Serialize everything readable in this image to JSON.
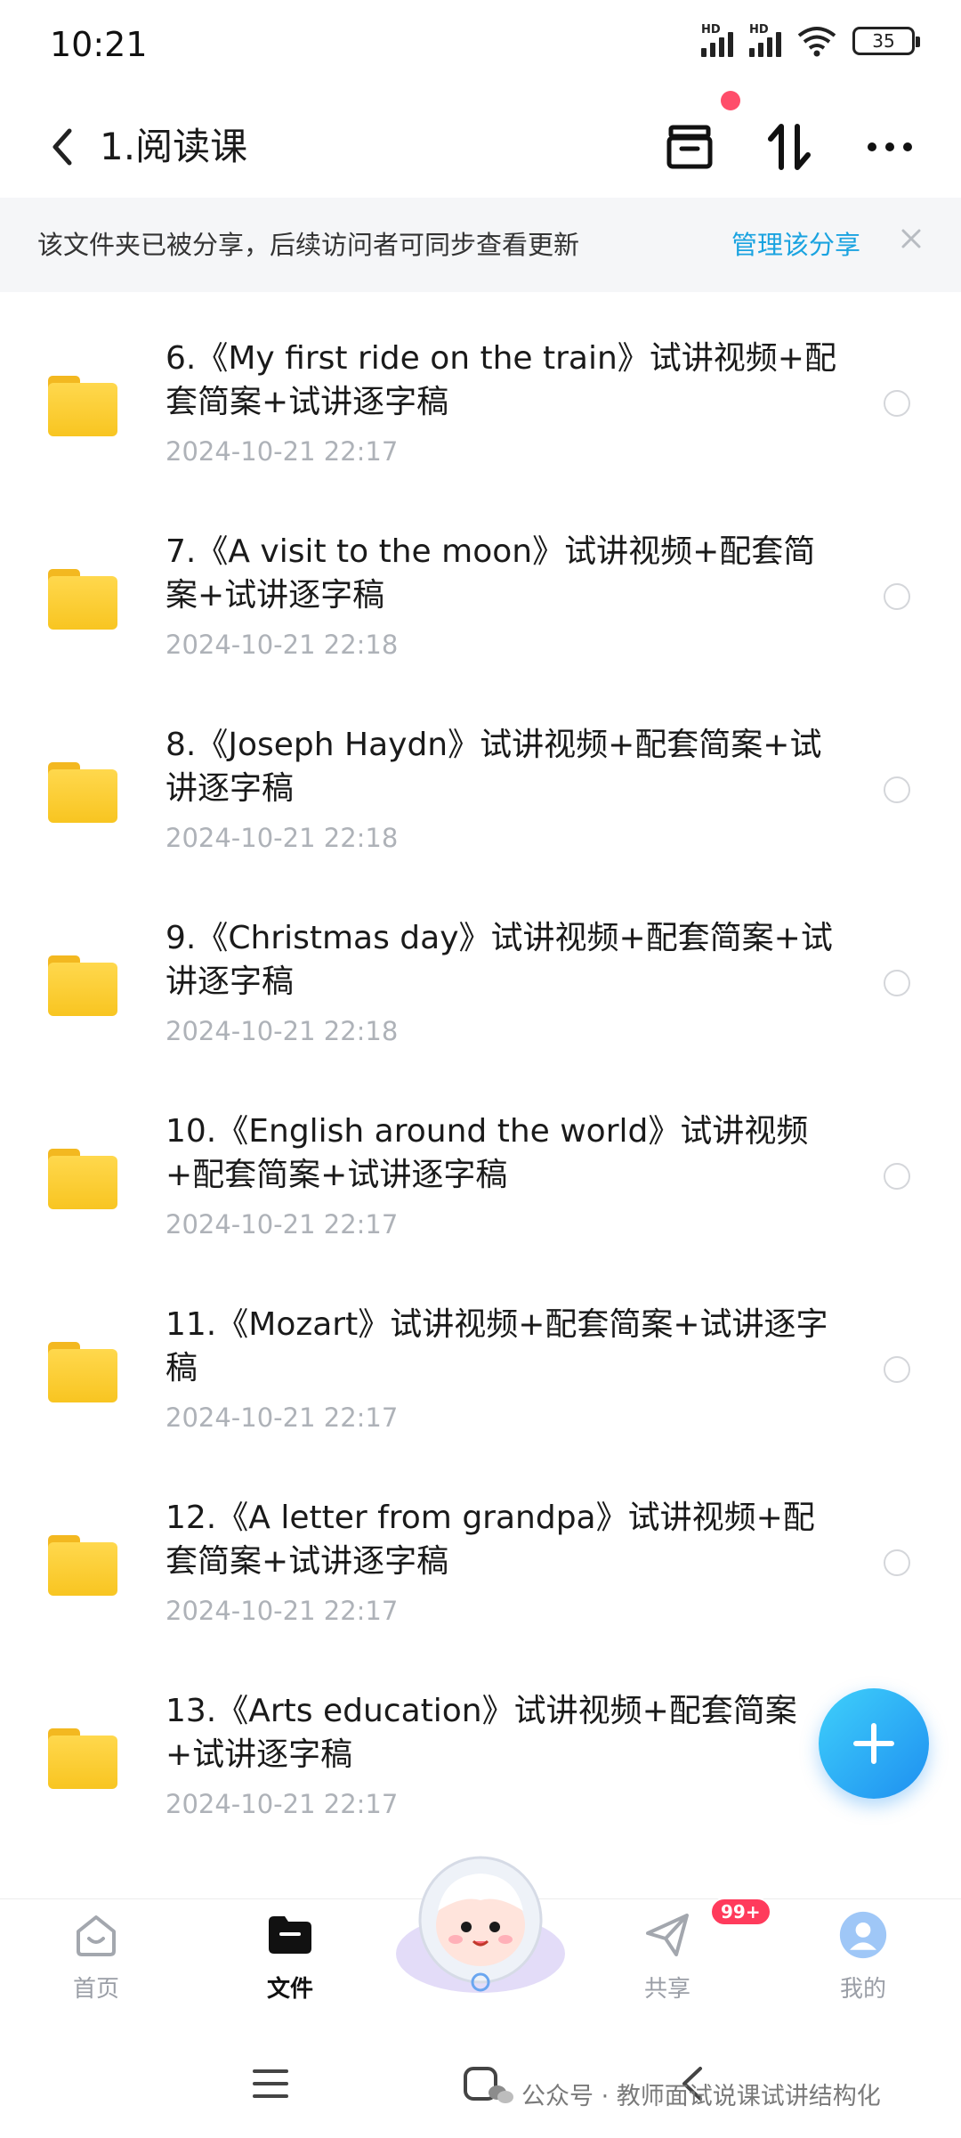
{
  "status_bar": {
    "time": "10:21",
    "battery": "35",
    "signal_label": "HD"
  },
  "header": {
    "title": "1.阅读课"
  },
  "share_notice": {
    "text": "该文件夹已被分享，后续访问者可同步查看更新",
    "link": "管理该分享"
  },
  "files": [
    {
      "name": "6.《My first ride on the train》试讲视频+配套简案+试讲逐字稿",
      "date": "2024-10-21  22:17"
    },
    {
      "name": "7.《A visit to the moon》试讲视频+配套简案+试讲逐字稿",
      "date": "2024-10-21  22:18"
    },
    {
      "name": "8.《Joseph Haydn》试讲视频+配套简案+试讲逐字稿",
      "date": "2024-10-21  22:18"
    },
    {
      "name": "9.《Christmas day》试讲视频+配套简案+试讲逐字稿",
      "date": "2024-10-21  22:18"
    },
    {
      "name": "10.《English around the world》试讲视频+配套简案+试讲逐字稿",
      "date": "2024-10-21  22:17"
    },
    {
      "name": "11.《Mozart》试讲视频+配套简案+试讲逐字稿",
      "date": "2024-10-21  22:17"
    },
    {
      "name": "12.《A letter from grandpa》试讲视频+配套简案+试讲逐字稿",
      "date": "2024-10-21  22:17"
    },
    {
      "name": "13.《Arts education》试讲视频+配套简案+试讲逐字稿",
      "date": "2024-10-21  22:17"
    }
  ],
  "bottom_nav": {
    "home": "首页",
    "files": "文件",
    "share": "共享",
    "share_badge": "99+",
    "mine": "我的"
  },
  "watermark": "公众号 · 教师面试说课试讲结构化",
  "colors": {
    "accent": "#1aa3e0",
    "folder": "#f8c521",
    "badge": "#ff3b5c"
  }
}
